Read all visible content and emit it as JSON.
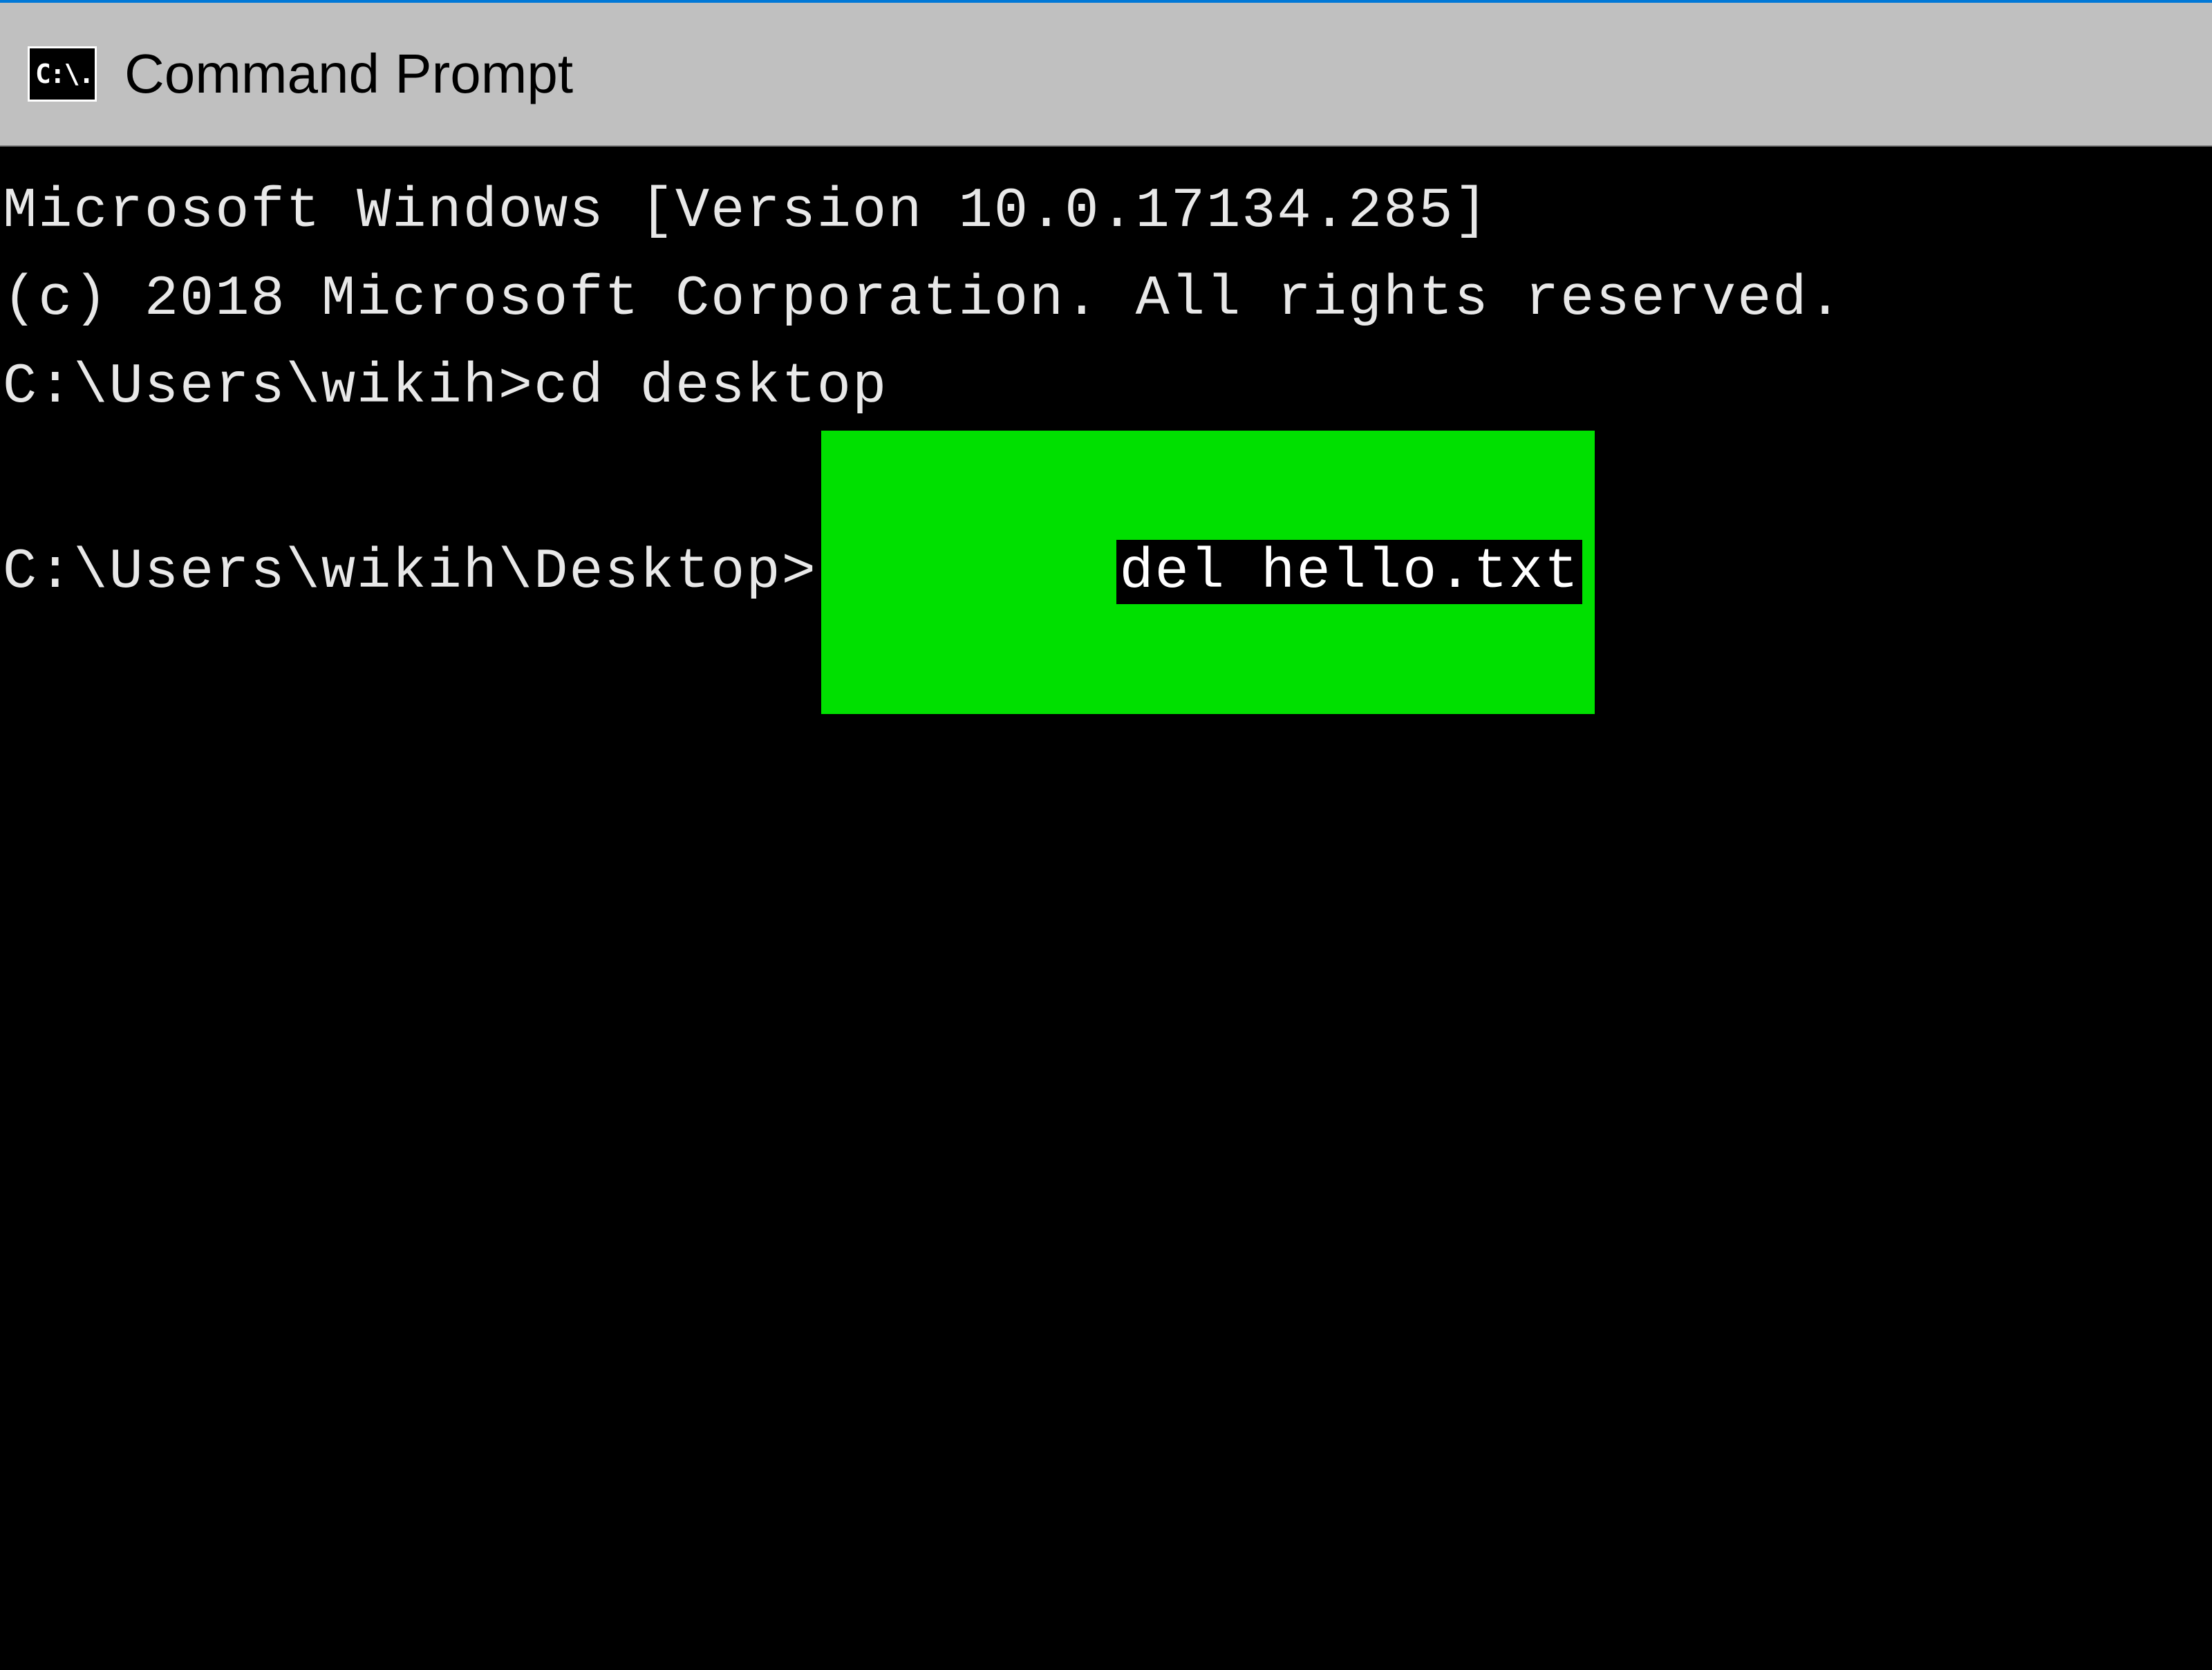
{
  "window": {
    "title": "Command Prompt",
    "icon_text": "C:\\."
  },
  "terminal": {
    "lines": [
      "Microsoft Windows [Version 10.0.17134.285]",
      "(c) 2018 Microsoft Corporation. All rights reserved.",
      "",
      "C:\\Users\\wikih>cd desktop",
      ""
    ],
    "active_prompt": "C:\\Users\\wikih\\Desktop>",
    "highlighted_command": "del hello.txt"
  },
  "colors": {
    "highlight": "#00e000",
    "titlebar_bg": "#c0c0c0",
    "terminal_bg": "#000000",
    "terminal_fg": "#e8e8e8",
    "accent": "#0078d7"
  }
}
